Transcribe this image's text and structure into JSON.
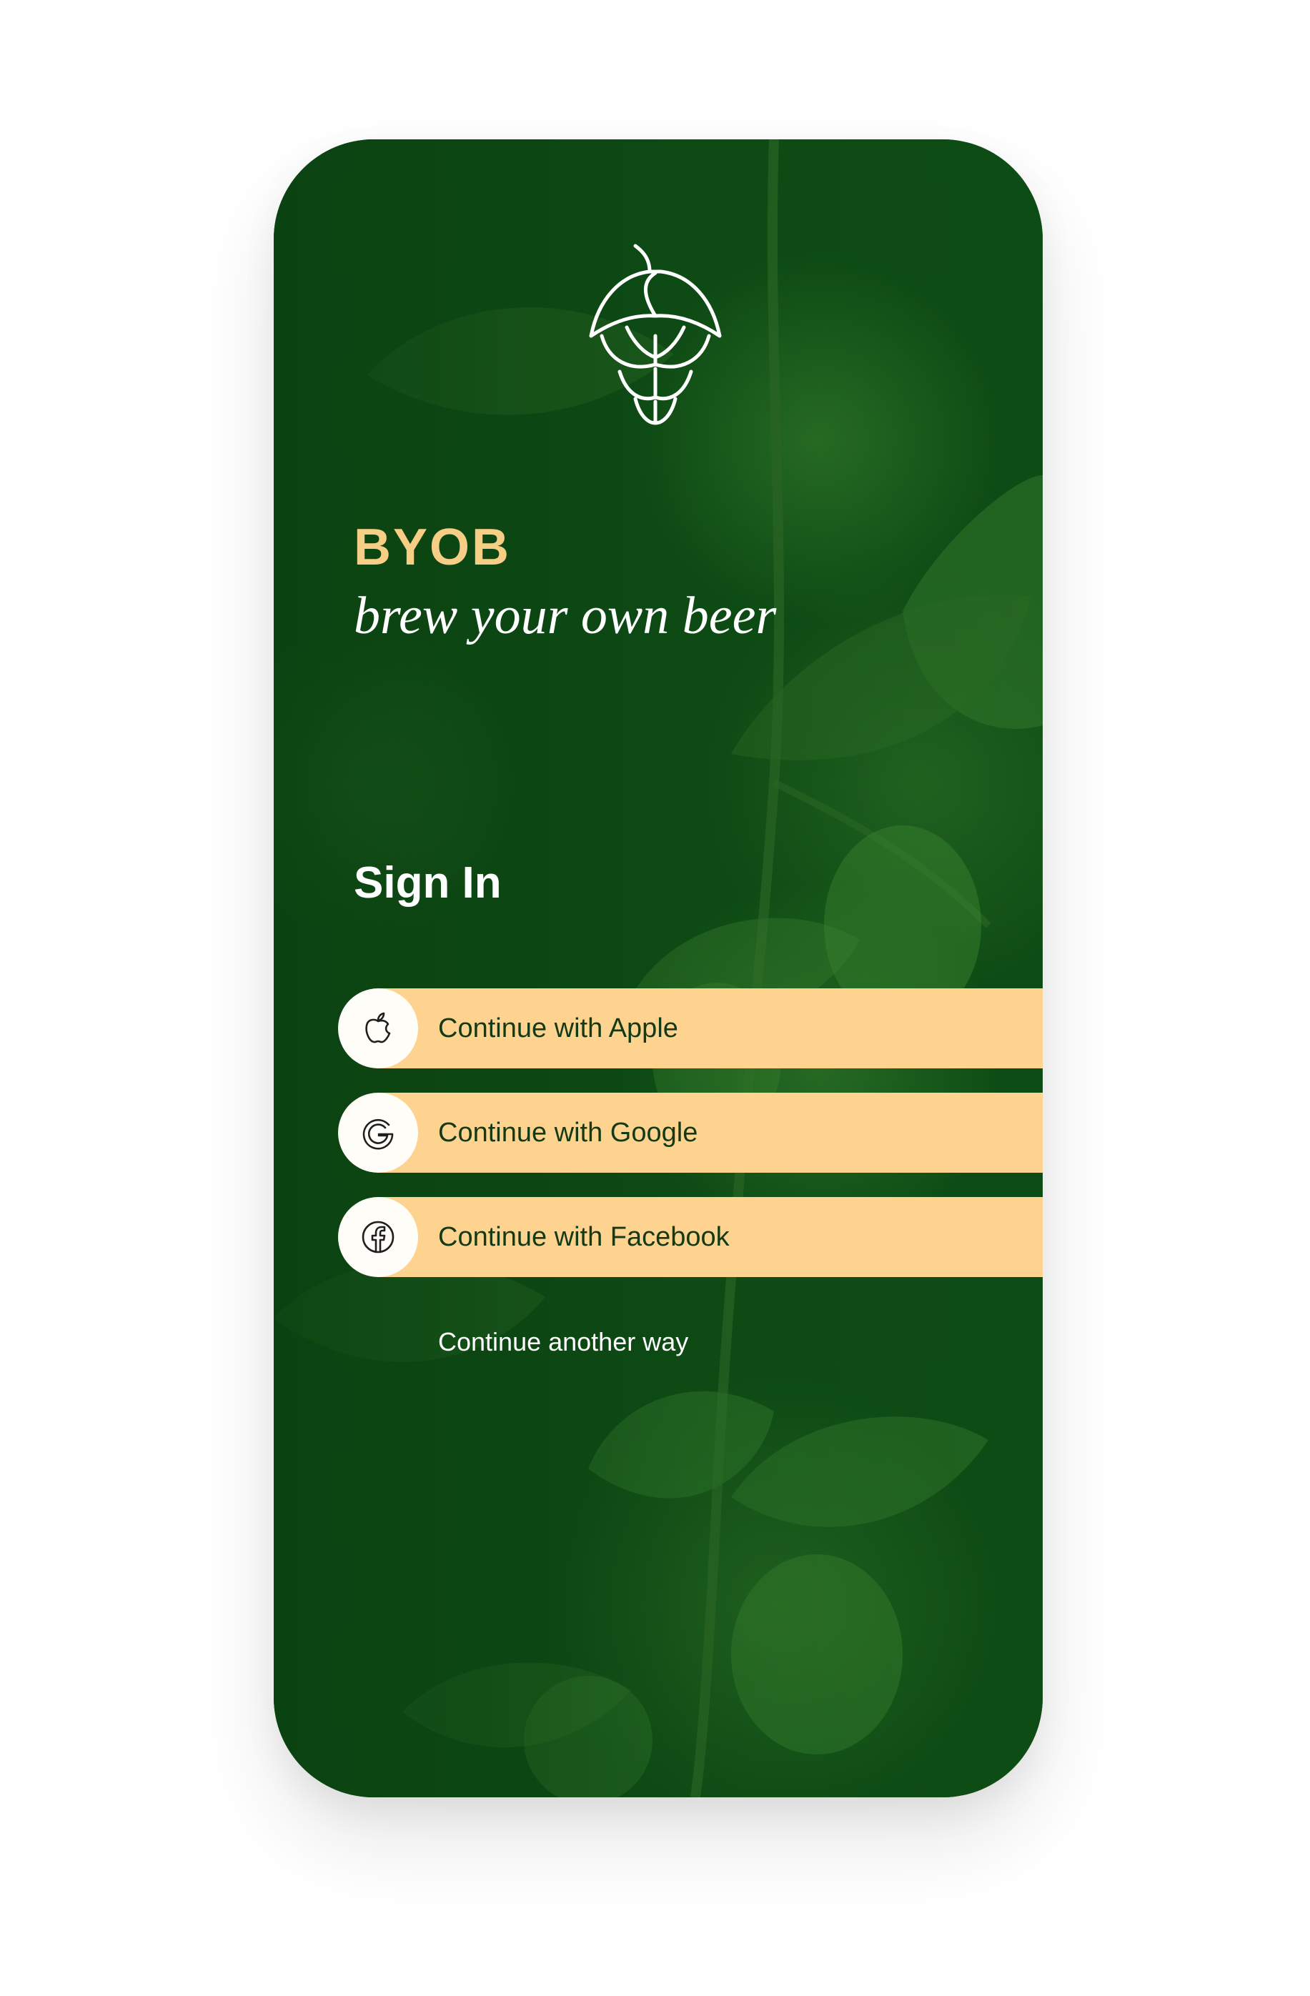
{
  "app": {
    "brand": "BYOB",
    "tagline": "brew your own beer",
    "logo_icon": "hop-cone-icon"
  },
  "signin": {
    "title": "Sign In",
    "buttons": [
      {
        "label": "Continue with Apple",
        "icon": "apple-icon"
      },
      {
        "label": "Continue with Google",
        "icon": "google-icon"
      },
      {
        "label": "Continue with Facebook",
        "icon": "facebook-icon"
      }
    ],
    "alternate_link": "Continue another way"
  },
  "colors": {
    "background": "#0d4a14",
    "accent": "#f7ce86",
    "button_bg": "#fed38f",
    "button_text": "#133a14",
    "icon_circle": "#fffdf8"
  }
}
